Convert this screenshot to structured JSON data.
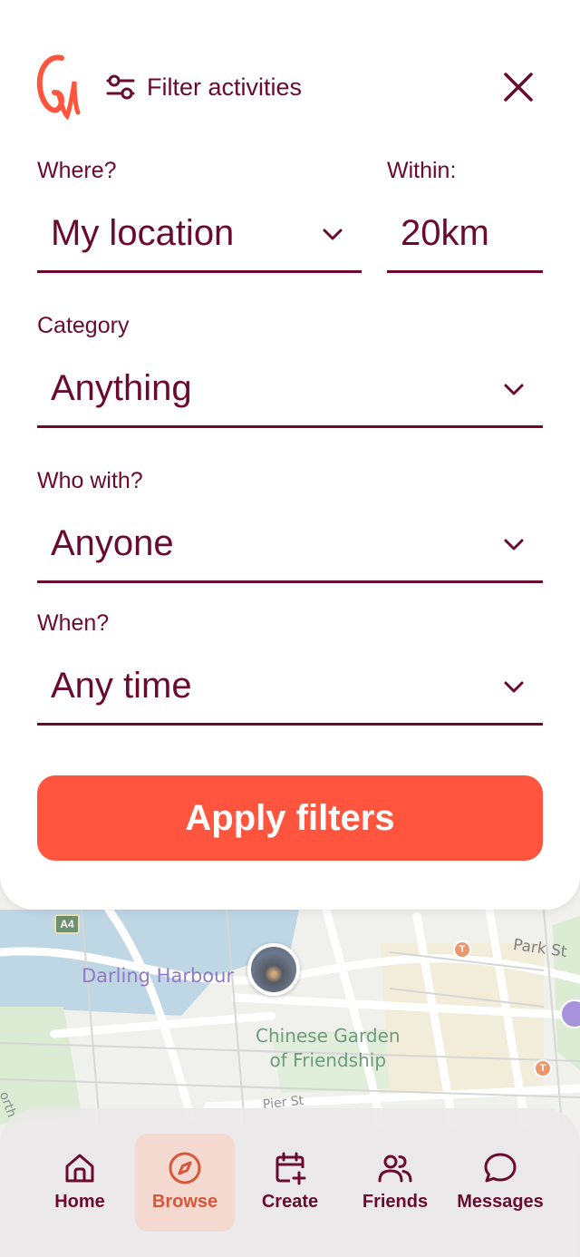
{
  "header": {
    "title": "Filter activities"
  },
  "filters": {
    "where": {
      "label": "Where?",
      "value": "My location"
    },
    "within": {
      "label": "Within:",
      "value": "20km"
    },
    "category": {
      "label": "Category",
      "value": "Anything"
    },
    "who_with": {
      "label": "Who with?",
      "value": "Anyone"
    },
    "when": {
      "label": "When?",
      "value": "Any time"
    }
  },
  "apply_button": {
    "label": "Apply filters"
  },
  "map": {
    "labels": {
      "darling_harbour": "Darling Harbour",
      "chinese_garden_line1": "Chinese Garden",
      "chinese_garden_line2": "of Friendship",
      "park_st": "Park St",
      "pier_st": "Pier St",
      "north": "orth",
      "route": "A4"
    }
  },
  "nav": {
    "items": [
      {
        "label": "Home",
        "icon": "home-icon",
        "active": false
      },
      {
        "label": "Browse",
        "icon": "compass-icon",
        "active": true
      },
      {
        "label": "Create",
        "icon": "calendar-plus-icon",
        "active": false
      },
      {
        "label": "Friends",
        "icon": "users-icon",
        "active": false
      },
      {
        "label": "Messages",
        "icon": "chat-icon",
        "active": false
      }
    ]
  },
  "colors": {
    "primary": "#6b0a2f",
    "accent": "#ff553e",
    "browse_active_bg": "#f3d9cf",
    "browse_active_text": "#d9563a"
  }
}
